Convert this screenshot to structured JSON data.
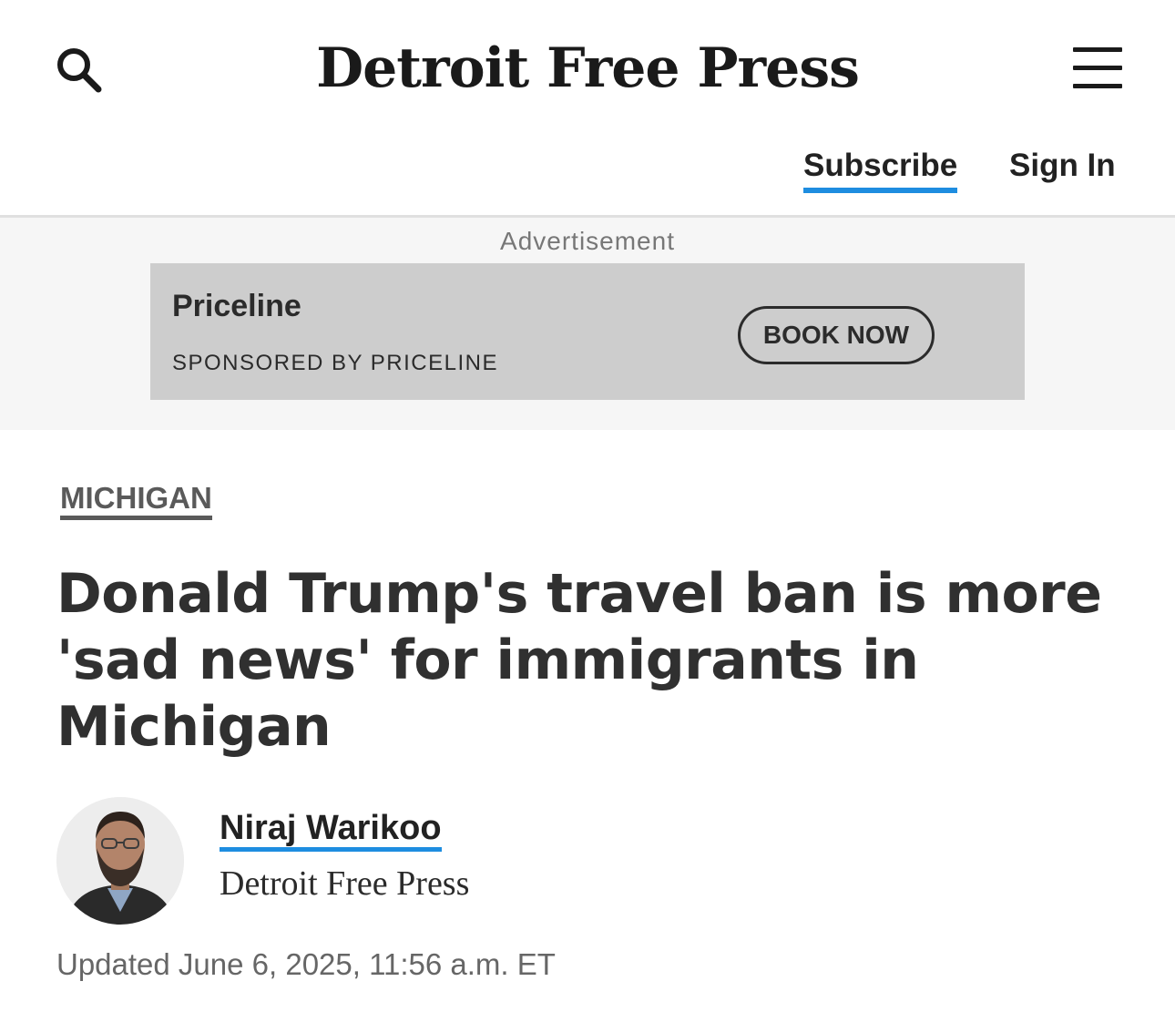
{
  "header": {
    "logo_text": "Detroit Free Press",
    "search_icon": "search-icon",
    "menu_icon": "hamburger-menu-icon",
    "subscribe_label": "Subscribe",
    "signin_label": "Sign In",
    "accent_color": "#1e8de0"
  },
  "ad": {
    "label": "Advertisement",
    "brand": "Priceline",
    "sponsor": "SPONSORED BY PRICELINE",
    "cta": "BOOK NOW"
  },
  "article": {
    "section": "MICHIGAN",
    "headline": "Donald Trump's travel ban is more 'sad news' for immigrants in Michigan",
    "author_name": "Niraj Warikoo",
    "author_publication": "Detroit Free Press",
    "updated": "Updated June 6, 2025, 11:56 a.m. ET"
  }
}
